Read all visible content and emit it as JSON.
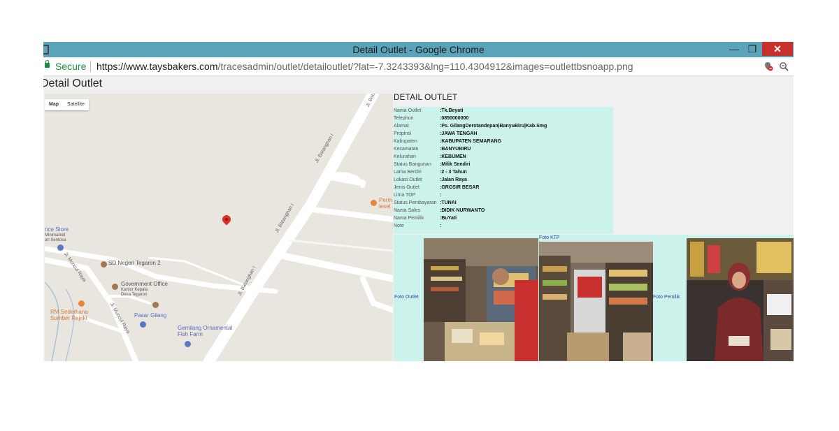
{
  "window": {
    "title": "Detail Outlet - Google Chrome",
    "minimize_glyph": "—",
    "maximize_glyph": "❐",
    "close_glyph": "✕"
  },
  "addressbar": {
    "secure_label": "Secure",
    "url_host": "https://www.taysbakers.com",
    "url_path": "/tracesadmin/outlet/detailoutlet/?lat=-7.3243393&lng=110.4304912&images=outlettbsnoapp.png",
    "icons": [
      "location-blocked-icon",
      "zoom-icon"
    ]
  },
  "page": {
    "heading": "Detail Outlet"
  },
  "map": {
    "type_map": "Map",
    "type_satellite": "Satellite",
    "labels": {
      "place_store": "nce Store",
      "place_store_sub1": "Minimarket",
      "place_store_sub2": "an Sentosa",
      "school": "SD Negeri Tegaron 2",
      "gov_office": "Government Office",
      "gov_office_sub1": "Kantor Kepala",
      "gov_office_sub2": "Desa Tegaron",
      "rm": "RM Sederhana",
      "rm_sub": "Sumber Rejeki",
      "pasar": "Pasar Gilang",
      "gemilang": "Gemilang Ornamental",
      "gemilang_sub": "Fish Farm",
      "perma": "Perm",
      "perma_sub": "lesel"
    },
    "streets": {
      "bata_top": "Jl. Bata",
      "batanghan1": "Jl. Batanghan I",
      "batanghan2": "Jl. Batanghan I",
      "batanghan3": "Jl. Batanghan I",
      "muncul1": "Jl. Muncul Raya",
      "muncul2": "Jl. Muncul Raya"
    }
  },
  "detail": {
    "title": "DETAIL OUTLET",
    "rows": [
      {
        "label": "Nama Outlet",
        "value": ":Tk.Beyati"
      },
      {
        "label": "Telephon",
        "value": ":0850000000"
      },
      {
        "label": "Alamat",
        "value": ":Ps. GilangDerotandepan|BanyuBiru|Kab.Smg"
      },
      {
        "label": "Propinsi",
        "value": ":JAWA TENGAH"
      },
      {
        "label": "Kabupaten",
        "value": ":KABUPATEN SEMARANG"
      },
      {
        "label": "Kecamatan",
        "value": ":BANYUBIRU"
      },
      {
        "label": "Kelurahan",
        "value": ":KEBUMEN"
      },
      {
        "label": "Status Bangunan",
        "value": ":Milik Sendiri"
      },
      {
        "label": "Lama Berdiri",
        "value": ":2 - 3 Tahun"
      },
      {
        "label": "Lokasi Outlet",
        "value": ":Jalan Raya"
      },
      {
        "label": "Jenis Outlet",
        "value": ":GROSIR BESAR"
      },
      {
        "label": "Lima TOP",
        "value": ":"
      },
      {
        "label": "Status Pembayaran",
        "value": ":TUNAI"
      },
      {
        "label": "Nama Sales",
        "value": ":DIDIK NURWANTO"
      },
      {
        "label": "Nama Pemilik",
        "value": ":BuYati"
      },
      {
        "label": "Note",
        "value": ":"
      }
    ]
  },
  "photos": {
    "foto_outlet": "Foto Outlet",
    "foto_ktp": "Foto KTP",
    "foto_pemilik": "Foto Pemilik"
  },
  "colors": {
    "titlebar": "#5ba3b8",
    "close_button": "#c9302c",
    "secure_green": "#1e8e3e",
    "detail_bg": "#ccf2ec",
    "map_bg": "#e8e6df",
    "pin_red": "#d93025"
  }
}
